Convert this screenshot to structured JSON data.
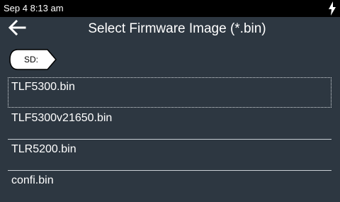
{
  "status_bar": {
    "datetime": "Sep 4 8:13 am",
    "charging_icon": "charging-bolt-icon"
  },
  "header": {
    "back_icon": "arrow-left-icon",
    "title": "Select Firmware Image (*.bin)"
  },
  "volume": {
    "label": "SD:"
  },
  "files": [
    {
      "name": "TLF5300.bin",
      "selected": true
    },
    {
      "name": "TLF5300v21650.bin",
      "selected": false
    },
    {
      "name": "TLR5200.bin",
      "selected": false
    },
    {
      "name": "confi.bin",
      "selected": false
    }
  ],
  "colors": {
    "background": "#2d3741",
    "status_bar": "#000000",
    "text": "#ffffff",
    "divider": "#c9cfd4"
  }
}
